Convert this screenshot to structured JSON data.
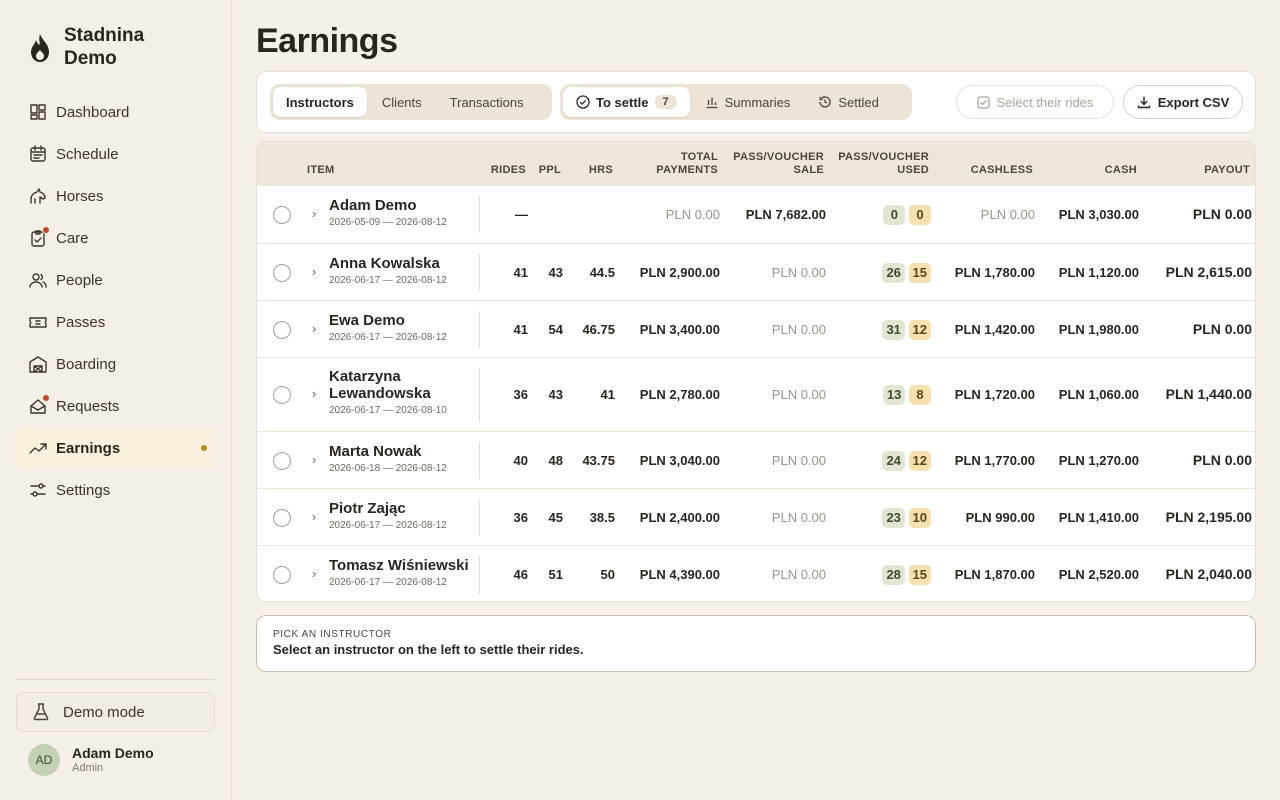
{
  "brand": {
    "line1": "Stadnina",
    "line2": "Demo"
  },
  "nav": [
    {
      "label": "Dashboard",
      "icon": "dashboard-icon",
      "alert": false,
      "active": false
    },
    {
      "label": "Schedule",
      "icon": "calendar-icon",
      "alert": false,
      "active": false
    },
    {
      "label": "Horses",
      "icon": "horse-icon",
      "alert": false,
      "active": false
    },
    {
      "label": "Care",
      "icon": "clipboard-check-icon",
      "alert": true,
      "active": false
    },
    {
      "label": "People",
      "icon": "people-icon",
      "alert": false,
      "active": false
    },
    {
      "label": "Passes",
      "icon": "ticket-icon",
      "alert": false,
      "active": false
    },
    {
      "label": "Boarding",
      "icon": "barn-icon",
      "alert": false,
      "active": false
    },
    {
      "label": "Requests",
      "icon": "inbox-icon",
      "alert": true,
      "active": false
    },
    {
      "label": "Earnings",
      "icon": "trending-up-icon",
      "alert": false,
      "active": true
    },
    {
      "label": "Settings",
      "icon": "sliders-icon",
      "alert": false,
      "active": false
    }
  ],
  "demo_mode": "Demo mode",
  "user": {
    "initials": "AD",
    "name": "Adam Demo",
    "role": "Admin"
  },
  "page_title": "Earnings",
  "tabs_view": [
    "Instructors",
    "Clients",
    "Transactions"
  ],
  "tabs_status": [
    {
      "label": "To settle",
      "count": "7"
    },
    {
      "label": "Summaries"
    },
    {
      "label": "Settled"
    }
  ],
  "select_rides": "Select their rides",
  "export_csv": "Export CSV",
  "columns": {
    "item": "ITEM",
    "rides": "RIDES",
    "ppl": "PPL",
    "hrs": "HRS",
    "total_payments_1": "TOTAL",
    "total_payments_2": "PAYMENTS",
    "pv_sale_1": "PASS/VOUCHER",
    "pv_sale_2": "SALE",
    "pv_used_1": "PASS/VOUCHER",
    "pv_used_2": "USED",
    "cashless": "CASHLESS",
    "cash": "CASH",
    "payout": "PAYOUT"
  },
  "rows": [
    {
      "name": "Adam Demo",
      "dates": "2026-05-09 — 2026-08-12",
      "rides": "—",
      "ppl": "",
      "hrs": "",
      "total": "PLN 0.00",
      "total_muted": true,
      "pv_sale": "PLN 7,682.00",
      "pv_sale_muted": false,
      "used_g": "0",
      "used_y": "0",
      "cashless": "PLN 0.00",
      "cashless_muted": true,
      "cash": "PLN 3,030.00",
      "payout": "PLN 0.00"
    },
    {
      "name": "Anna Kowalska",
      "dates": "2026-06-17 — 2026-08-12",
      "rides": "41",
      "ppl": "43",
      "hrs": "44.5",
      "total": "PLN 2,900.00",
      "total_muted": false,
      "pv_sale": "PLN 0.00",
      "pv_sale_muted": true,
      "used_g": "26",
      "used_y": "15",
      "cashless": "PLN 1,780.00",
      "cashless_muted": false,
      "cash": "PLN 1,120.00",
      "payout": "PLN 2,615.00"
    },
    {
      "name": "Ewa Demo",
      "dates": "2026-06-17 — 2026-08-12",
      "rides": "41",
      "ppl": "54",
      "hrs": "46.75",
      "total": "PLN 3,400.00",
      "total_muted": false,
      "pv_sale": "PLN 0.00",
      "pv_sale_muted": true,
      "used_g": "31",
      "used_y": "12",
      "cashless": "PLN 1,420.00",
      "cashless_muted": false,
      "cash": "PLN 1,980.00",
      "payout": "PLN 0.00"
    },
    {
      "name": "Katarzyna Lewandowska",
      "dates": "2026-06-17 — 2026-08-10",
      "rides": "36",
      "ppl": "43",
      "hrs": "41",
      "total": "PLN 2,780.00",
      "total_muted": false,
      "pv_sale": "PLN 0.00",
      "pv_sale_muted": true,
      "used_g": "13",
      "used_y": "8",
      "cashless": "PLN 1,720.00",
      "cashless_muted": false,
      "cash": "PLN 1,060.00",
      "payout": "PLN 1,440.00"
    },
    {
      "name": "Marta Nowak",
      "dates": "2026-06-18 — 2026-08-12",
      "rides": "40",
      "ppl": "48",
      "hrs": "43.75",
      "total": "PLN 3,040.00",
      "total_muted": false,
      "pv_sale": "PLN 0.00",
      "pv_sale_muted": true,
      "used_g": "24",
      "used_y": "12",
      "cashless": "PLN 1,770.00",
      "cashless_muted": false,
      "cash": "PLN 1,270.00",
      "payout": "PLN 0.00"
    },
    {
      "name": "Piotr Zając",
      "dates": "2026-06-17 — 2026-08-12",
      "rides": "36",
      "ppl": "45",
      "hrs": "38.5",
      "total": "PLN 2,400.00",
      "total_muted": false,
      "pv_sale": "PLN 0.00",
      "pv_sale_muted": true,
      "used_g": "23",
      "used_y": "10",
      "cashless": "PLN 990.00",
      "cashless_muted": false,
      "cash": "PLN 1,410.00",
      "payout": "PLN 2,195.00"
    },
    {
      "name": "Tomasz Wiśniewski",
      "dates": "2026-06-17 — 2026-08-12",
      "rides": "46",
      "ppl": "51",
      "hrs": "50",
      "total": "PLN 4,390.00",
      "total_muted": false,
      "pv_sale": "PLN 0.00",
      "pv_sale_muted": true,
      "used_g": "28",
      "used_y": "15",
      "cashless": "PLN 1,870.00",
      "cashless_muted": false,
      "cash": "PLN 2,520.00",
      "payout": "PLN 2,040.00"
    }
  ],
  "hint": {
    "label": "PICK AN INSTRUCTOR",
    "text": "Select an instructor on the left to settle their rides."
  },
  "colors": {
    "accent": "#b88a1f",
    "alert": "#c9452c",
    "pill_green": "#dfe6d2",
    "pill_yellow": "#f5e2b0"
  }
}
